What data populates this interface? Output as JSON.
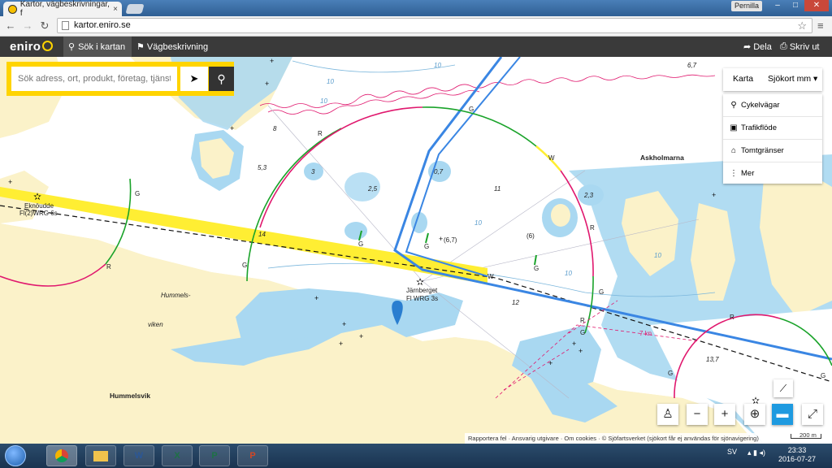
{
  "browser": {
    "tab_title": "Kartor, vägbeskrivningar, f",
    "tab_close": "×",
    "user_name": "Pernilla",
    "url": "kartor.eniro.se",
    "win_min": "–",
    "win_max": "□",
    "win_close": "✕"
  },
  "header": {
    "logo": "eniro",
    "search_tab": "Sök i kartan",
    "route_tab": "Vägbeskrivning",
    "share": "Dela",
    "print": "Skriv ut"
  },
  "search": {
    "placeholder": "Sök adress, ort, produkt, företag, tjänst"
  },
  "layers": {
    "map_button": "Karta",
    "sea_button": "Sjökort mm",
    "items": [
      "Cykelvägar",
      "Trafikflöde",
      "Tomtgränser",
      "Mer"
    ]
  },
  "map": {
    "labels": {
      "eknoudde": "Eknöudde",
      "eknoudde_light": "Fl(2)WRG 6s",
      "jarnberget": "Järnberget",
      "jarnberget_light": "Fl WRG 3s",
      "hummels": "Hummels-",
      "viken": "viken",
      "hummelsvik": "Hummelsvik",
      "askholmarna": "Askholmarna",
      "speed": "7 kn"
    },
    "sector_letters": [
      "G",
      "R",
      "G",
      "W",
      "R",
      "G",
      "R",
      "G",
      "W",
      "G",
      "G",
      "R",
      "G",
      "G",
      "G",
      "R",
      "G"
    ],
    "depths": [
      "6,7",
      "8",
      "5,3",
      "3",
      "0,7",
      "2,5",
      "11",
      "2,3",
      "(6,7)",
      "(6)",
      "12",
      "13,7",
      "10",
      "10",
      "10",
      "10",
      "10",
      "10",
      "14"
    ]
  },
  "footer": {
    "report": "Rapportera fel",
    "publisher": "Ansvarig utgivare",
    "cookies": "Om cookies",
    "copyright": "© Sjöfartsverket (sjökort får ej användas för sjönavigering)",
    "scale": "200 m"
  },
  "taskbar": {
    "lang": "SV",
    "time": "23:33",
    "date": "2016-07-27",
    "apps": [
      "W",
      "X",
      "P",
      "P"
    ]
  },
  "colors": {
    "land": "#fbf2c9",
    "shallow": "#a9d8f1",
    "route": "#3a86e3",
    "fairway": "#ffee33",
    "sector_red": "#e0186e",
    "sector_green": "#1aa32a",
    "brand_yellow": "#ffd400"
  }
}
